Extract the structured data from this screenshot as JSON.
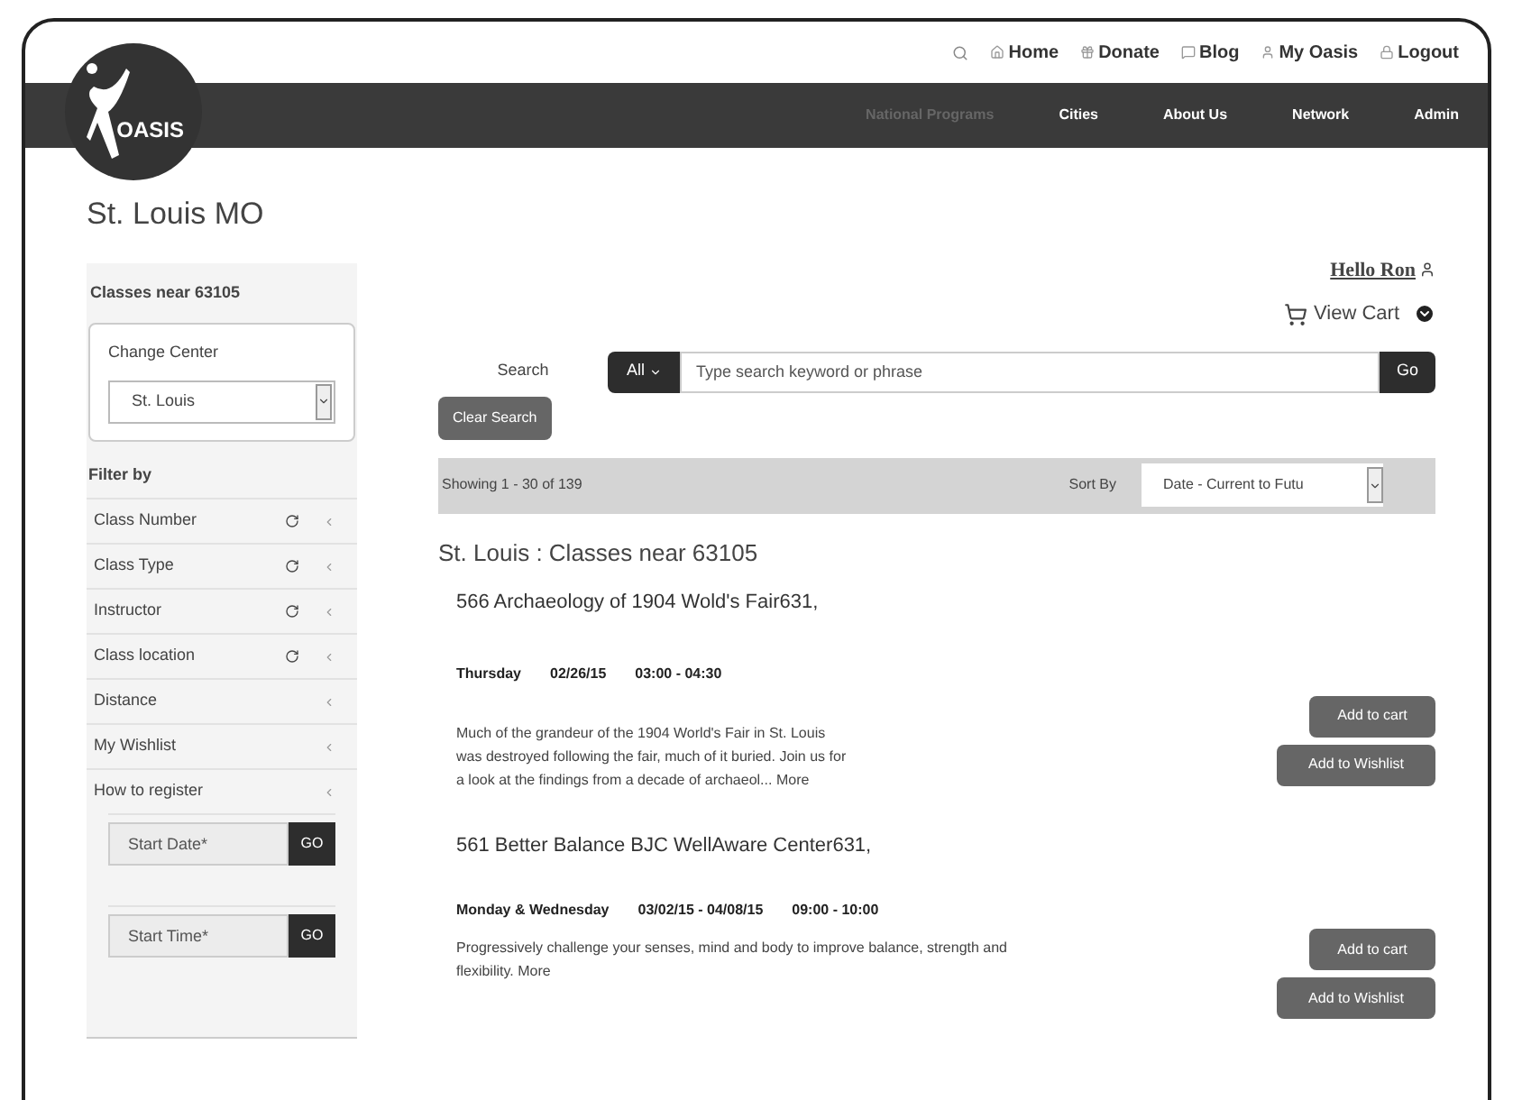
{
  "top_links": [
    {
      "label": "Home"
    },
    {
      "label": "Donate"
    },
    {
      "label": "Blog"
    },
    {
      "label": "My Oasis"
    },
    {
      "label": "Logout"
    }
  ],
  "logo": {
    "text": "OASIS"
  },
  "nav": [
    {
      "label": "National Programs",
      "selected": true
    },
    {
      "label": "Cities",
      "selected": false
    },
    {
      "label": "About Us",
      "selected": false
    },
    {
      "label": "Network",
      "selected": false
    },
    {
      "label": "Admin",
      "selected": false
    }
  ],
  "page_title": "St. Louis MO",
  "sidebar": {
    "heading": "Classes near 63105",
    "change_center": {
      "label": "Change Center",
      "value": "St. Louis"
    },
    "filter_heading": "Filter by",
    "filters": [
      {
        "label": "Class Number",
        "kind": "resettable"
      },
      {
        "label": "Class Type",
        "kind": "resettable"
      },
      {
        "label": "Instructor",
        "kind": "resettable"
      },
      {
        "label": "Class location",
        "kind": "resettable"
      },
      {
        "label": "Distance",
        "kind": "plain"
      },
      {
        "label": "My Wishlist",
        "kind": "plain"
      },
      {
        "label": "How to register",
        "kind": "plain"
      }
    ],
    "pickers": [
      {
        "placeholder": "Start Date*",
        "button": "GO"
      },
      {
        "placeholder": "Start Time*",
        "button": "GO"
      }
    ]
  },
  "greeting": "Hello Ron",
  "view_cart": "View Cart",
  "search": {
    "label": "Search",
    "scope": "All",
    "placeholder": "Type search keyword or phrase",
    "button": "Go",
    "clear": "Clear Search"
  },
  "results_bar": {
    "showing": "Showing 1 - 30 of 139",
    "sort_label": "Sort By",
    "sort_value": "Date - Current to Futu"
  },
  "results_heading": "St. Louis : Classes near 63105",
  "classes": [
    {
      "title": "566 Archaeology of 1904 Wold's Fair631,",
      "days": "Thursday",
      "dates": "02/26/15",
      "time": "03:00 - 04:30",
      "description": "Much of the grandeur of the 1904 World's Fair in St. Louis was destroyed following the fair, much of it buried. Join us for a look at the findings from a decade of archaeol...",
      "more": "More",
      "cart": "Add to cart",
      "wishlist": "Add to Wishlist"
    },
    {
      "title": "561 Better Balance BJC WellAware Center631,",
      "days": "Monday & Wednesday",
      "dates": "03/02/15 - 04/08/15",
      "time": "09:00 - 10:00",
      "description": "Progressively challenge your senses, mind and body to improve balance, strength and flexibility.",
      "more": "More",
      "cart": "Add to cart",
      "wishlist": "Add to Wishlist"
    }
  ]
}
